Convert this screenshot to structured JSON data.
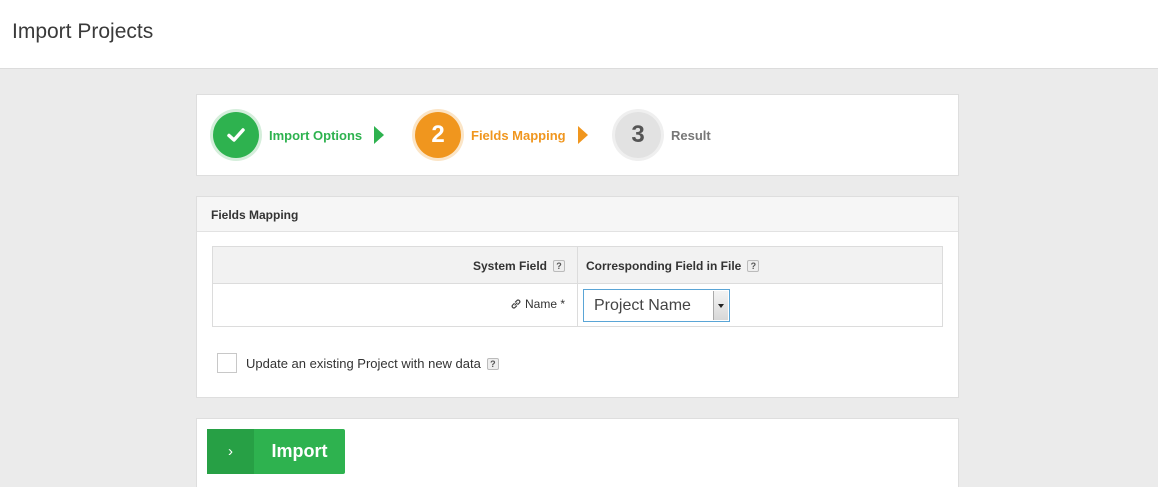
{
  "header": {
    "title": "Import Projects"
  },
  "steps": [
    {
      "number": "",
      "label": "Import Options",
      "state": "done",
      "icon": "check-icon",
      "color": "#2eb24f"
    },
    {
      "number": "2",
      "label": "Fields Mapping",
      "state": "active",
      "color": "#f0961e"
    },
    {
      "number": "3",
      "label": "Result",
      "state": "pending",
      "color": "#e2e2e2"
    }
  ],
  "mapping": {
    "title": "Fields Mapping",
    "columns": {
      "system_field": "System Field",
      "file_field": "Corresponding Field in File"
    },
    "help_glyph": "?",
    "rows": [
      {
        "system_field": "Name *",
        "icon": "link-icon",
        "file_field_value": "Project Name"
      }
    ],
    "update_existing": {
      "label": "Update an existing Project with new data",
      "checked": false
    }
  },
  "actions": {
    "import_label": "Import",
    "import_icon": "chevron-right-icon",
    "import_icon_glyph": "›"
  }
}
